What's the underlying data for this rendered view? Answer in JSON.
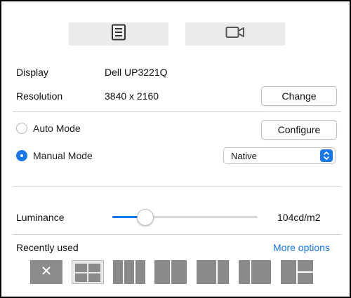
{
  "tabs": [
    {
      "name": "list-view",
      "icon": "list-icon"
    },
    {
      "name": "video-view",
      "icon": "video-camera-icon"
    }
  ],
  "display": {
    "label": "Display",
    "value": "Dell UP3221Q"
  },
  "resolution": {
    "label": "Resolution",
    "value": "3840 x 2160",
    "button": "Change"
  },
  "modes": {
    "auto": {
      "label": "Auto Mode",
      "checked": false,
      "button": "Configure"
    },
    "manual": {
      "label": "Manual Mode",
      "checked": true,
      "selected": "Native"
    }
  },
  "luminance": {
    "label": "Luminance",
    "value": "104cd/m2",
    "slider_fraction": 0.23
  },
  "recently_used": {
    "label": "Recently used",
    "more_options": "More options"
  },
  "colors": {
    "accent": "#1877e8",
    "tile": "#8a8a8a"
  },
  "layouts": [
    {
      "name": "close",
      "icon": "close-icon"
    },
    {
      "name": "grid-2x2",
      "selected": true
    },
    {
      "name": "three-columns"
    },
    {
      "name": "two-columns"
    },
    {
      "name": "wide-left-narrow-right"
    },
    {
      "name": "narrow-left-wide-right"
    },
    {
      "name": "left-plus-two-stacked-right"
    }
  ]
}
